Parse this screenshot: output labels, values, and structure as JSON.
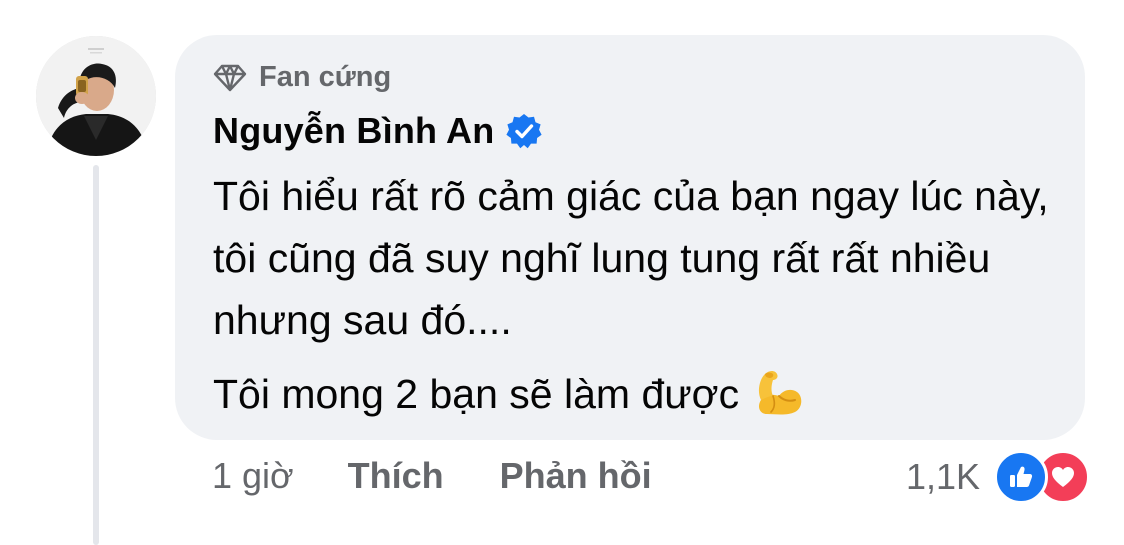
{
  "comment": {
    "badge": "Fan cứng",
    "author": "Nguyễn Bình An",
    "verified_icon": "verified-badge-icon",
    "text": [
      "Tôi hiểu rất rõ cảm giác của bạn ngay lúc này, tôi cũng đã suy nghĩ lung tung rất rất nhiều nhưng sau đó....",
      "Tôi mong 2 bạn sẽ làm được"
    ],
    "emoji_icon": "flexed-biceps-emoji",
    "time": "1 giờ",
    "like_label": "Thích",
    "reply_label": "Phản hồi",
    "reaction_count": "1,1K",
    "reactions": [
      "like-reaction-icon",
      "love-reaction-icon"
    ]
  },
  "colors": {
    "bubble_bg": "#f0f2f5",
    "secondary_text": "#65676b",
    "verified_blue": "#1877f2",
    "love_red": "#f33e58"
  }
}
